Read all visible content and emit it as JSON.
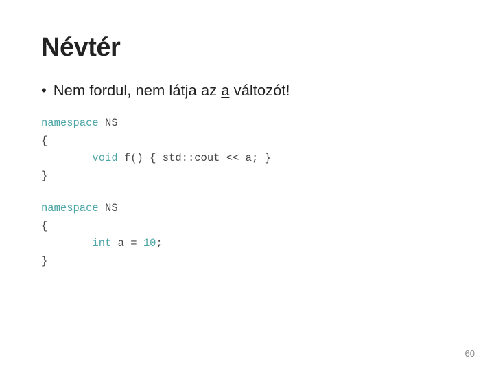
{
  "slide": {
    "title": "Névtér",
    "bullet": {
      "dot": "•",
      "text_before": "Nem fordul, nem látja az ",
      "text_underline": "a",
      "text_after": " változót!"
    },
    "code_block_1": {
      "lines": [
        {
          "type": "namespace_line",
          "kw": "namespace",
          "rest": " NS"
        },
        {
          "type": "plain",
          "text": "{"
        },
        {
          "type": "inner_void",
          "indent": "        ",
          "kw": "void",
          "rest": " f() { std::cout << a; }"
        },
        {
          "type": "plain",
          "text": "}"
        }
      ]
    },
    "code_block_2": {
      "lines": [
        {
          "type": "namespace_line",
          "kw": "namespace",
          "rest": " NS"
        },
        {
          "type": "plain",
          "text": "{"
        },
        {
          "type": "inner_int",
          "indent": "        ",
          "kw": "int",
          "rest": " a = ",
          "number": "10",
          "end": ";"
        },
        {
          "type": "plain",
          "text": "}"
        }
      ]
    },
    "page_number": "60"
  }
}
